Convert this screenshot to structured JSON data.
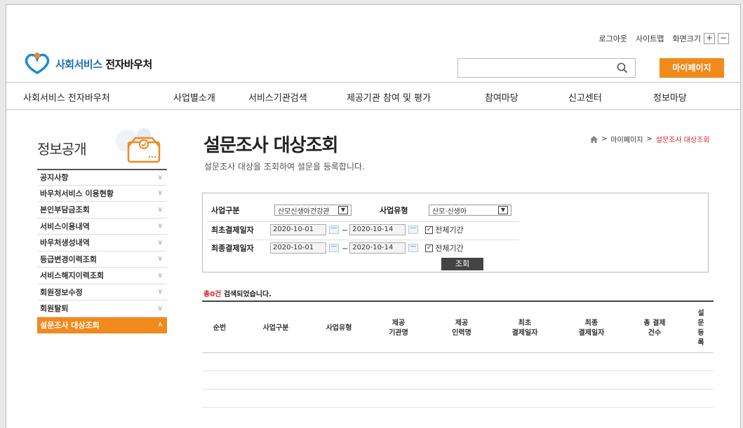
{
  "util": {
    "logout": "로그아웃",
    "sitemap": "사이트맵",
    "zoom_label": "화면크기",
    "zoom_in": "+",
    "zoom_out": "−"
  },
  "logo": {
    "part1": "사회서비스",
    "part2": "전자바우처"
  },
  "search": {
    "placeholder": "",
    "icon": "search-icon"
  },
  "mypage_button": "마이페이지",
  "gnb": [
    "사회서비스 전자바우처",
    "사업별소개",
    "서비스기관검색",
    "제공기관 참여 및 평가",
    "참여마당",
    "신고센터",
    "정보마당"
  ],
  "lnb": {
    "title": "정보공개",
    "items": [
      {
        "label": "공지사항"
      },
      {
        "label": "바우처서비스 이용현황"
      },
      {
        "label": "본인부담금조회"
      },
      {
        "label": "서비스이용내역"
      },
      {
        "label": "바우처생성내역"
      },
      {
        "label": "등급변경이력조회"
      },
      {
        "label": "서비스해지이력조회"
      },
      {
        "label": "회원정보수정"
      },
      {
        "label": "회원탈퇴"
      },
      {
        "label": "설문조사 대상조회",
        "active": true
      }
    ]
  },
  "page": {
    "title": "설문조사 대상조회",
    "description": "설문조사 대상을 조회하여 설문을 등록합니다."
  },
  "breadcrumb": {
    "home": "home-icon",
    "sep": ">",
    "level1": "마이페이지",
    "current": "설문조사 대상조회"
  },
  "filter": {
    "business_type_label": "사업구분",
    "business_type_value": "산모신생아건강관",
    "business_kind_label": "사업유형",
    "business_kind_value": "산모·신생아",
    "first_pay_label": "최초결제일자",
    "first_pay_from": "2020-10-01",
    "first_pay_to": "2020-10-14",
    "last_pay_label": "최종결제일자",
    "last_pay_from": "2020-10-01",
    "last_pay_to": "2020-10-14",
    "tilde": "~",
    "all_period_label": "전체기간",
    "search_button": "조회"
  },
  "result": {
    "count": "총0건",
    "suffix": " 검색되었습니다."
  },
  "table": {
    "columns": [
      "순번",
      "사업구분",
      "사업유형",
      "제공\n기관명",
      "제공\n인력명",
      "최초\n결제일자",
      "최종\n결제일자",
      "총 결제\n건수",
      "설\n문\n등\n록"
    ]
  },
  "colors": {
    "accent": "#f08a1c",
    "brand_blue": "#1f6fb8",
    "highlight_red": "#d9232d"
  }
}
